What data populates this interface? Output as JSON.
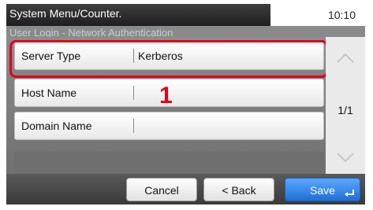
{
  "header": {
    "title": "System Menu/Counter.",
    "time": "10:10",
    "subtitle": "User Login - Network Authentication"
  },
  "rows": [
    {
      "label": "Server Type",
      "value": "Kerberos"
    },
    {
      "label": "Host Name",
      "value": ""
    },
    {
      "label": "Domain Name",
      "value": ""
    }
  ],
  "callout": "1",
  "pagination": {
    "label": "1/1"
  },
  "buttons": {
    "cancel": "Cancel",
    "back": "< Back",
    "save": "Save"
  },
  "icons": {
    "scroll_up": "chevron-up-icon",
    "scroll_down": "chevron-down-icon",
    "enter": "enter-icon"
  },
  "colors": {
    "highlight": "#e0001b",
    "save_button": "#2f86ea"
  }
}
